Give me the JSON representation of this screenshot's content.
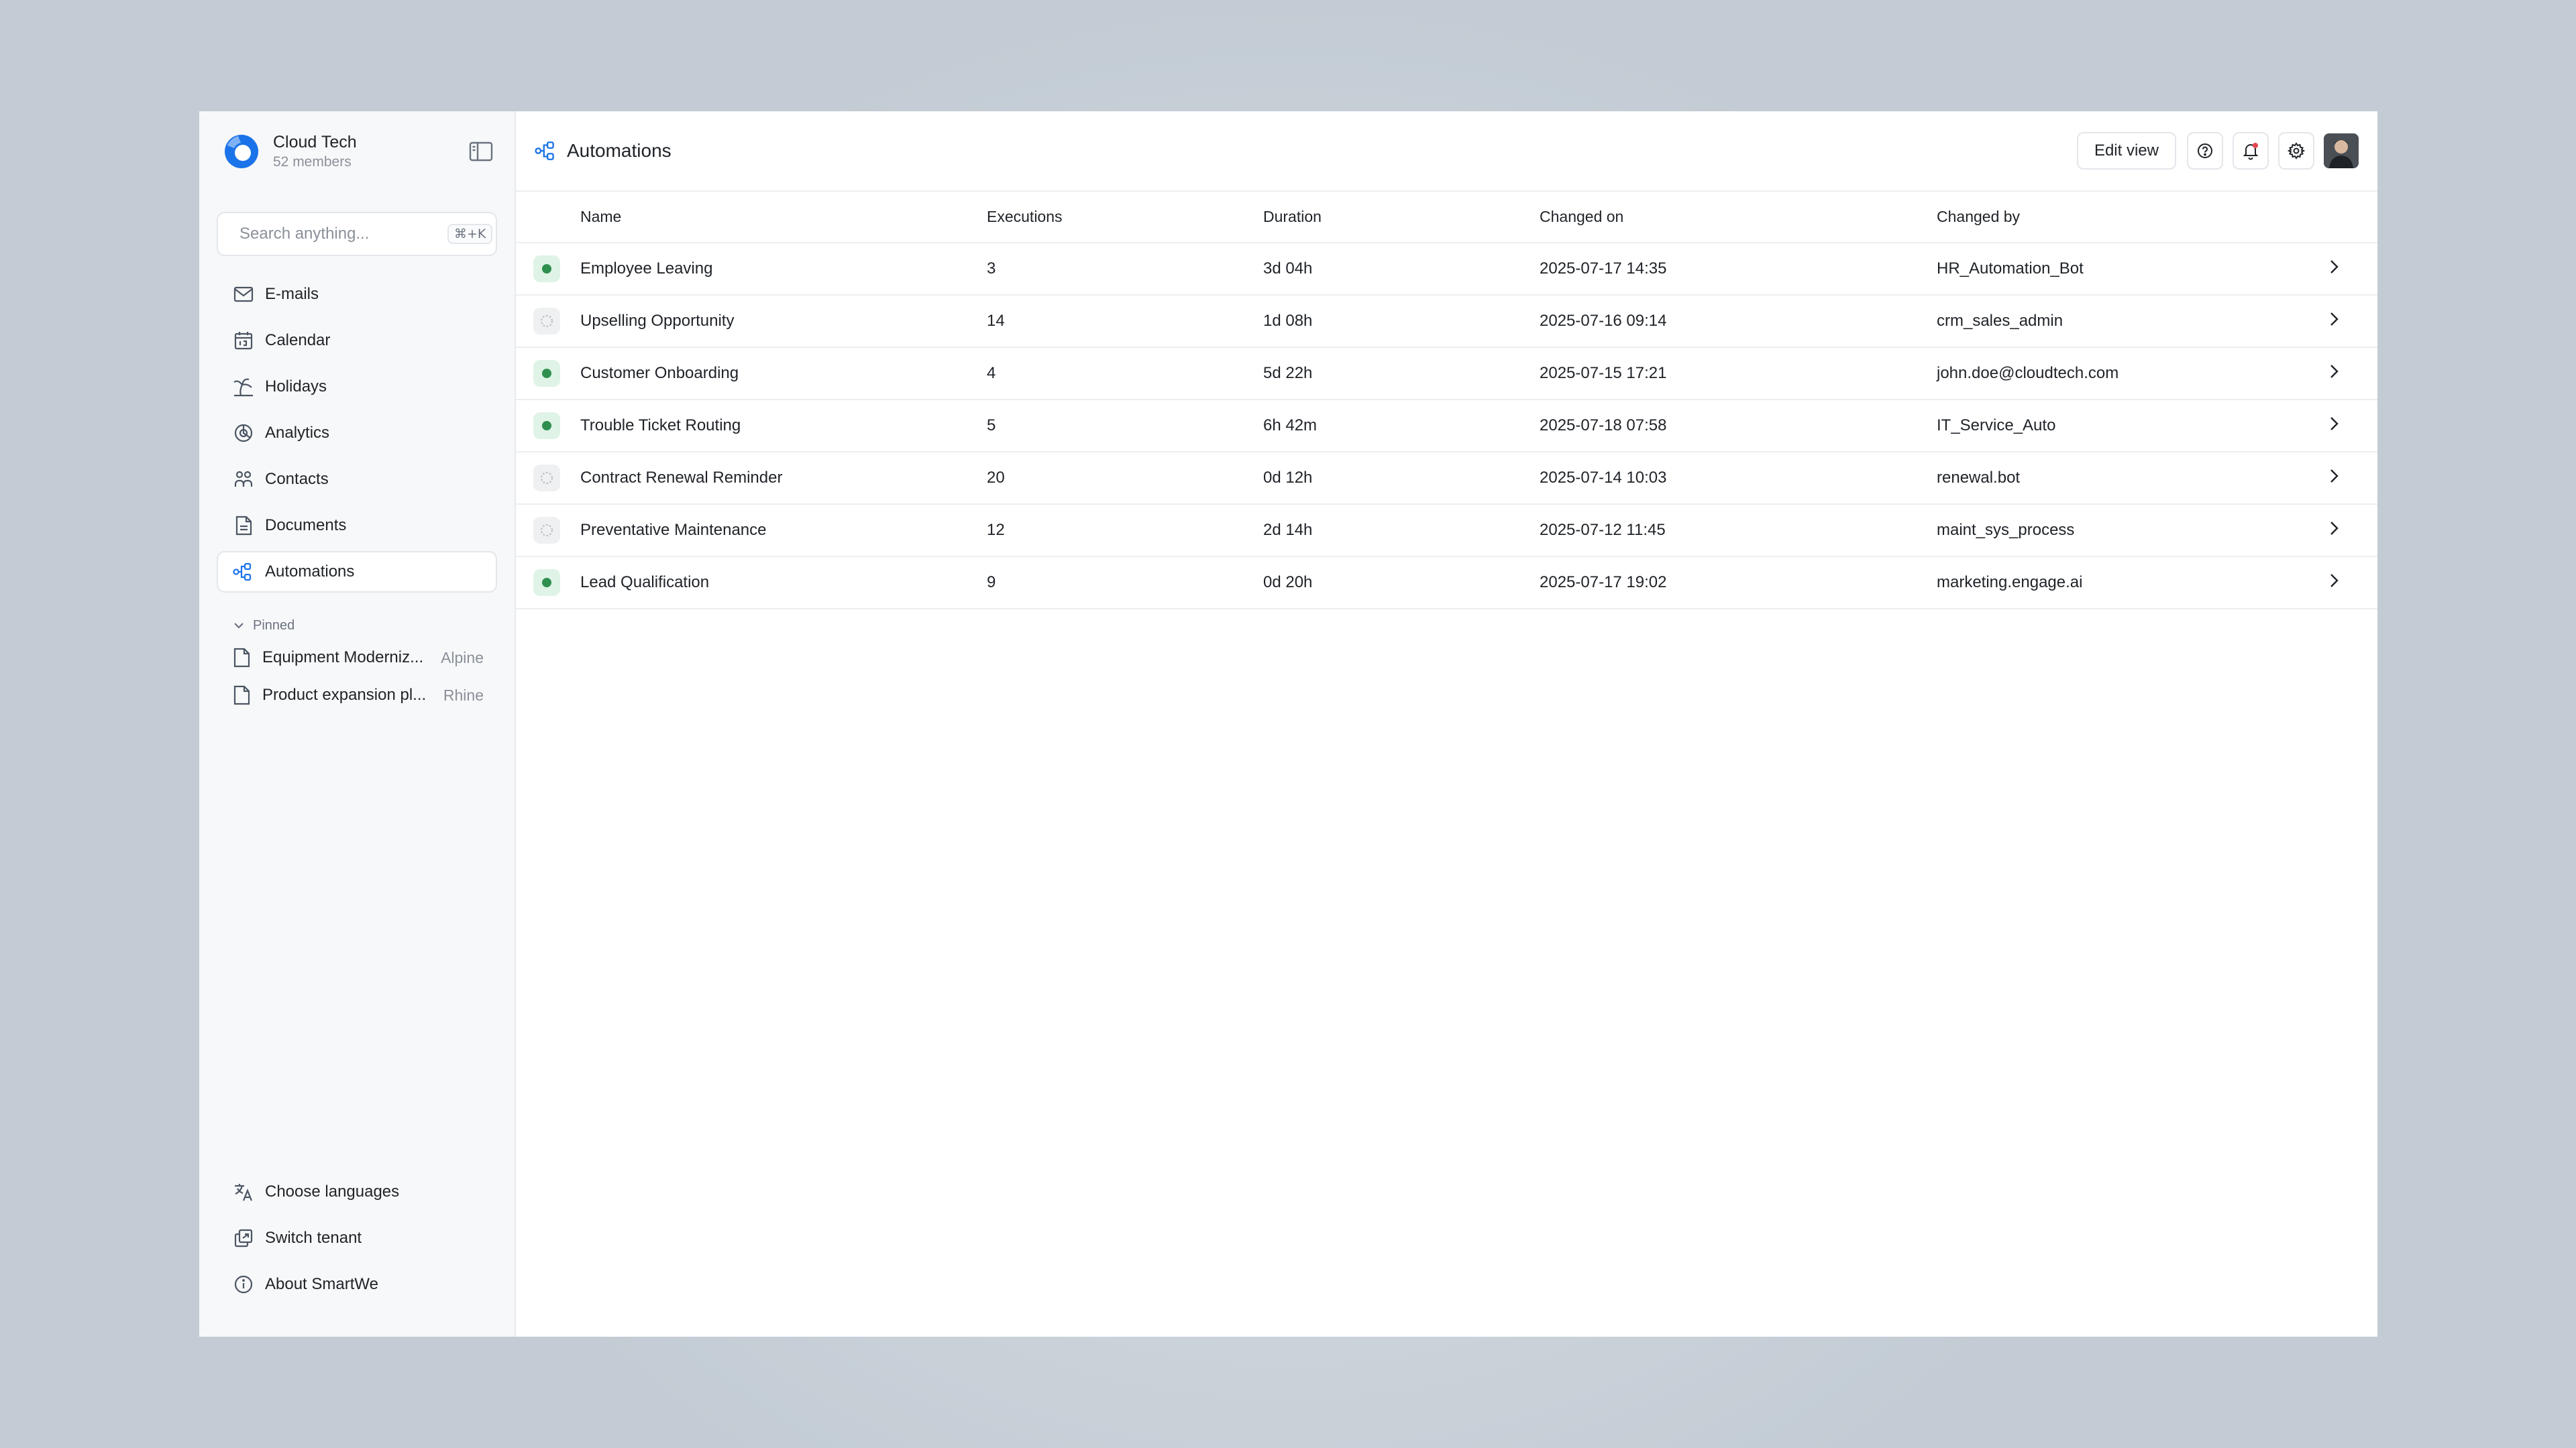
{
  "workspace": {
    "name": "Cloud Tech",
    "members": "52 members"
  },
  "search": {
    "placeholder": "Search anything...",
    "shortcut": "⌘+K"
  },
  "nav": [
    {
      "label": "E-mails",
      "icon": "mail-icon"
    },
    {
      "label": "Calendar",
      "icon": "calendar-icon"
    },
    {
      "label": "Holidays",
      "icon": "palm-tree-icon"
    },
    {
      "label": "Analytics",
      "icon": "analytics-icon"
    },
    {
      "label": "Contacts",
      "icon": "contacts-icon"
    },
    {
      "label": "Documents",
      "icon": "document-icon"
    },
    {
      "label": "Automations",
      "icon": "workflow-icon",
      "active": true
    }
  ],
  "pinned": {
    "label": "Pinned",
    "items": [
      {
        "name": "Equipment Moderniz...",
        "tag": "Alpine"
      },
      {
        "name": "Product expansion pl...",
        "tag": "Rhine"
      }
    ]
  },
  "footer_nav": [
    {
      "label": "Choose languages",
      "icon": "translate-icon"
    },
    {
      "label": "Switch tenant",
      "icon": "switch-icon"
    },
    {
      "label": "About SmartWe",
      "icon": "info-icon"
    }
  ],
  "header": {
    "title": "Automations",
    "edit_view": "Edit view"
  },
  "table": {
    "columns": [
      "Name",
      "Executions",
      "Duration",
      "Changed on",
      "Changed by"
    ],
    "rows": [
      {
        "status": "active",
        "name": "Employee Leaving",
        "executions": "3",
        "duration": "3d 04h",
        "changed_on": "2025-07-17 14:35",
        "changed_by": "HR_Automation_Bot"
      },
      {
        "status": "idle",
        "name": "Upselling Opportunity",
        "executions": "14",
        "duration": "1d 08h",
        "changed_on": "2025-07-16 09:14",
        "changed_by": "crm_sales_admin"
      },
      {
        "status": "active",
        "name": "Customer Onboarding",
        "executions": "4",
        "duration": "5d 22h",
        "changed_on": "2025-07-15 17:21",
        "changed_by": "john.doe@cloudtech.com"
      },
      {
        "status": "active",
        "name": "Trouble Ticket Routing",
        "executions": "5",
        "duration": "6h 42m",
        "changed_on": "2025-07-18 07:58",
        "changed_by": "IT_Service_Auto"
      },
      {
        "status": "idle",
        "name": "Contract Renewal Reminder",
        "executions": "20",
        "duration": "0d 12h",
        "changed_on": "2025-07-14 10:03",
        "changed_by": "renewal.bot"
      },
      {
        "status": "idle",
        "name": "Preventative Maintenance",
        "executions": "12",
        "duration": "2d 14h",
        "changed_on": "2025-07-12 11:45",
        "changed_by": "maint_sys_process"
      },
      {
        "status": "active",
        "name": "Lead Qualification",
        "executions": "9",
        "duration": "0d 20h",
        "changed_on": "2025-07-17 19:02",
        "changed_by": "marketing.engage.ai"
      }
    ]
  },
  "colors": {
    "brand": "#1a73e8",
    "active_status": "#2f8f4e",
    "notification": "#e5484d"
  }
}
